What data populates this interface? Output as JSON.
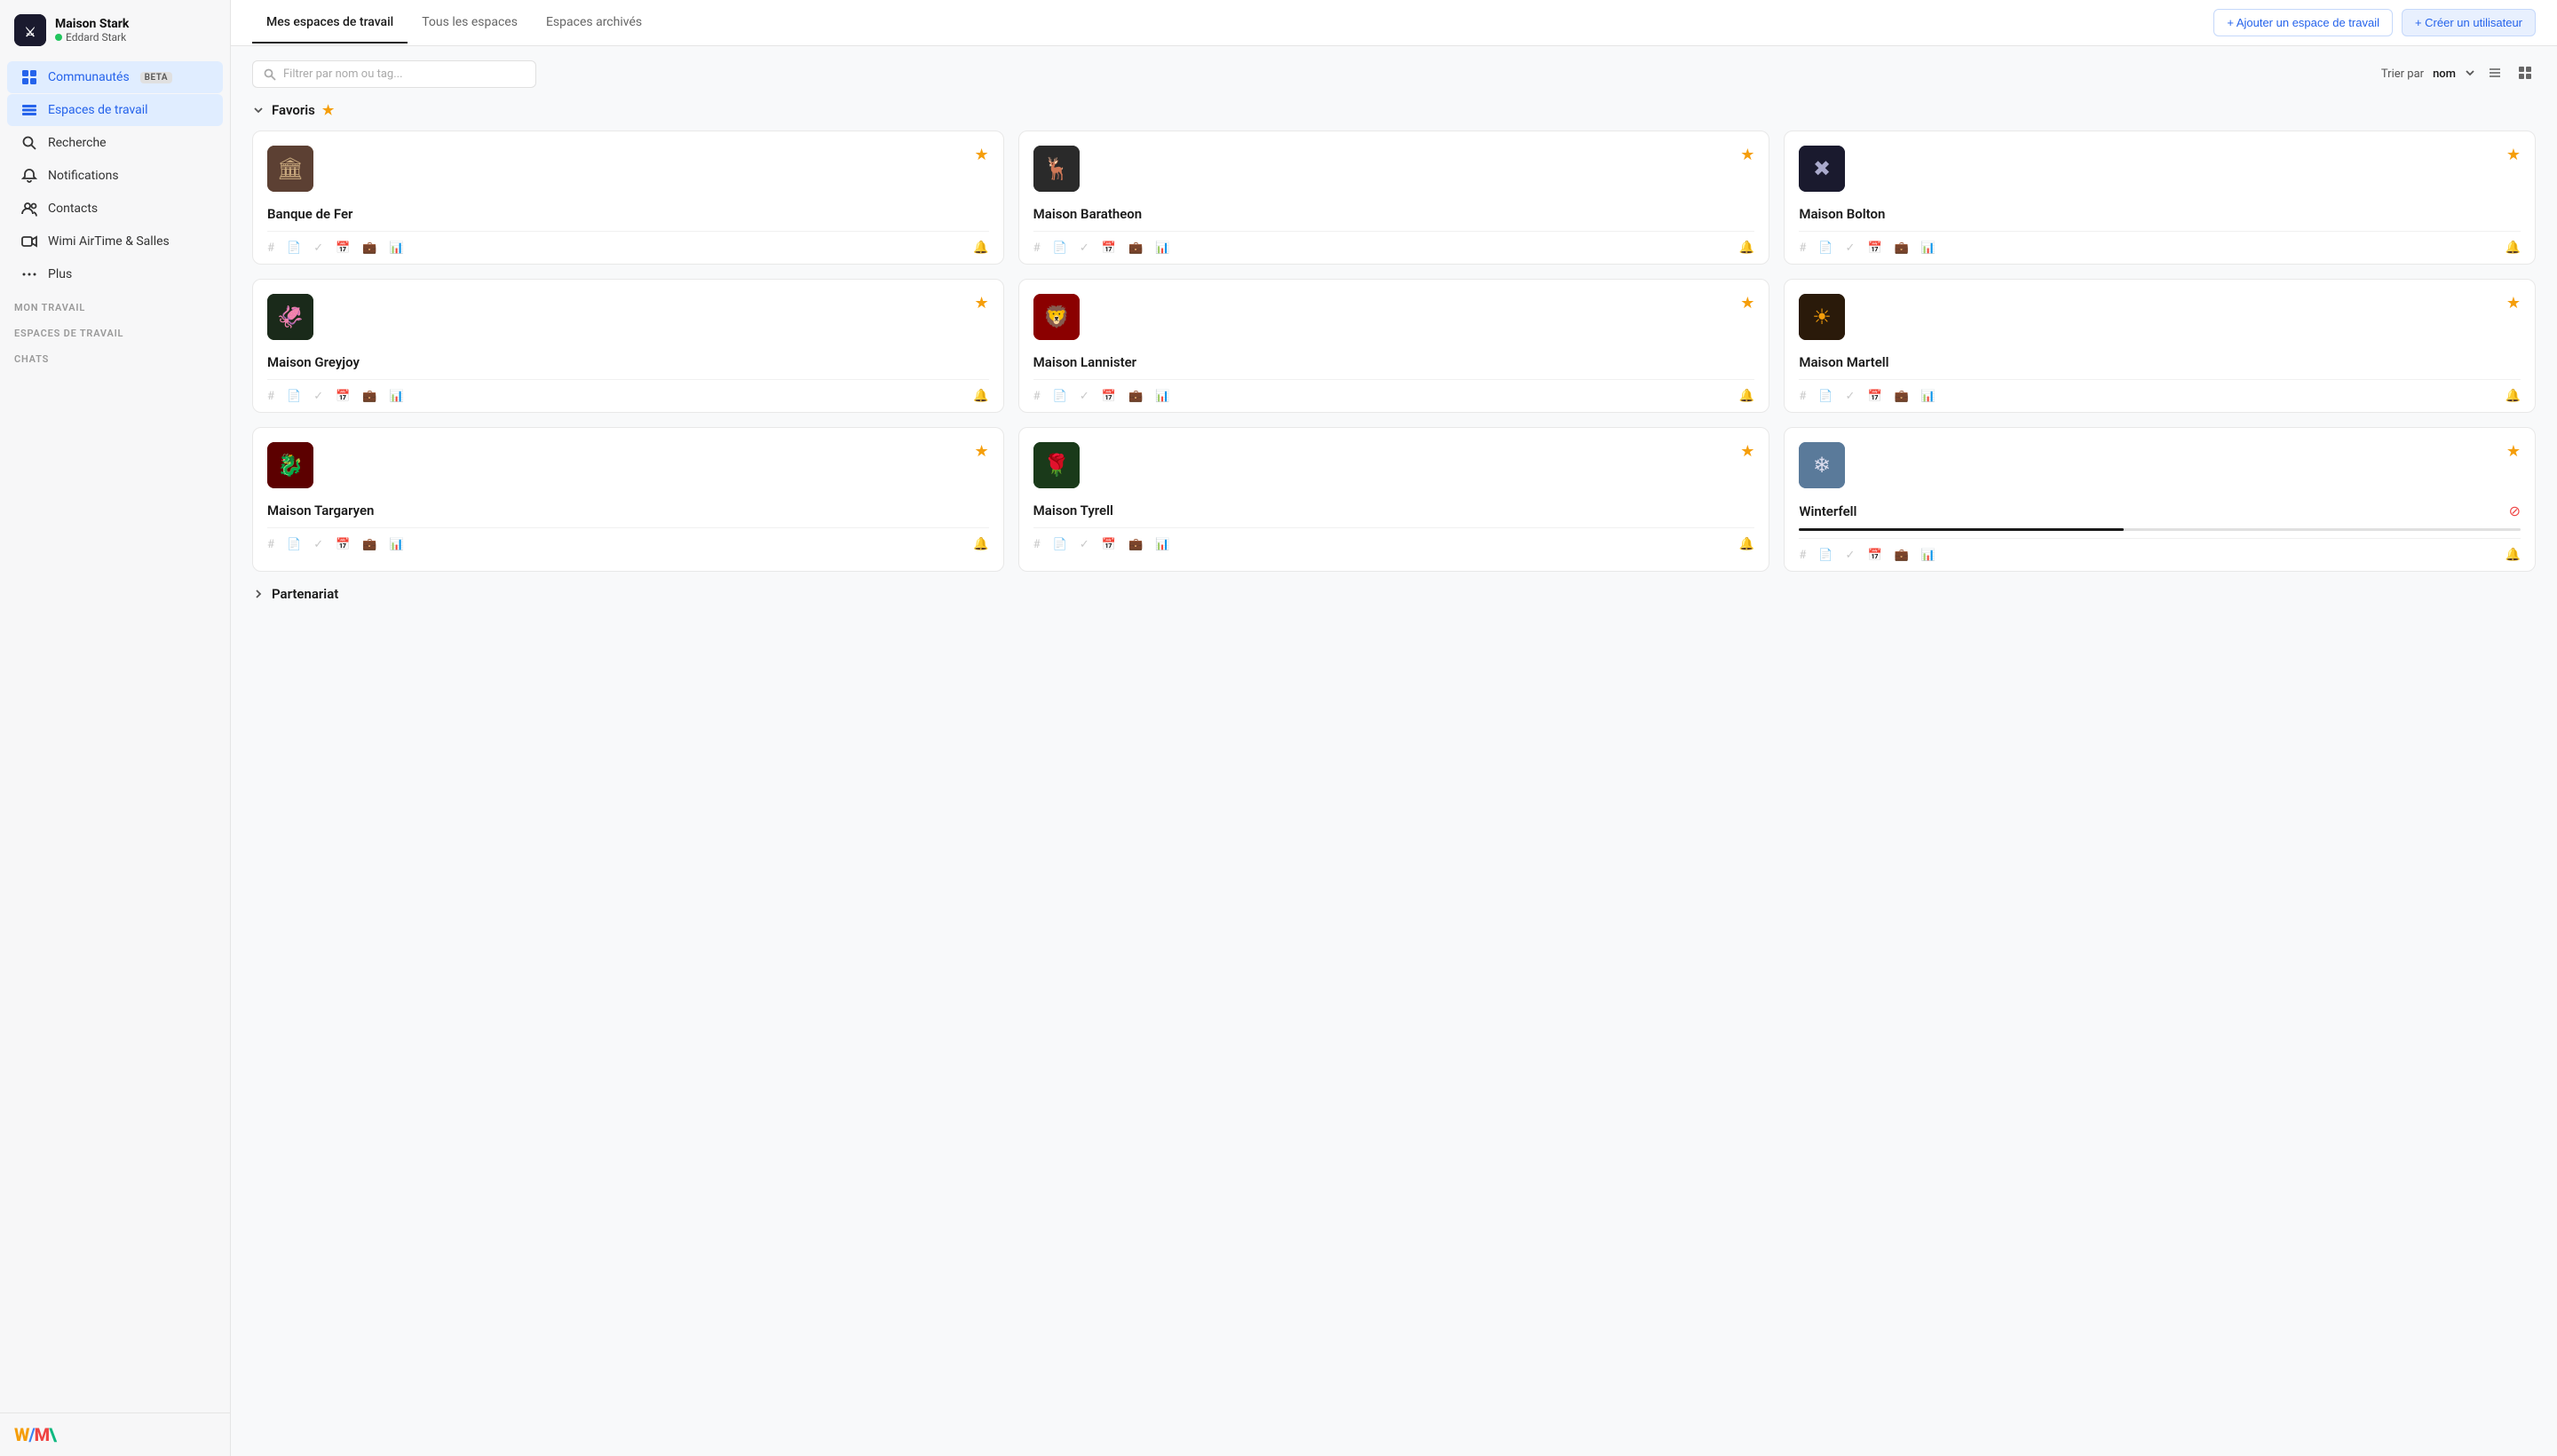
{
  "sidebar": {
    "company": "Maison Stark",
    "user": "Eddard Stark",
    "nav": [
      {
        "id": "communities",
        "label": "Communautés",
        "badge": "BETA",
        "icon": "grid"
      },
      {
        "id": "workspaces",
        "label": "Espaces de travail",
        "icon": "layers",
        "active": true
      },
      {
        "id": "search",
        "label": "Recherche",
        "icon": "search"
      },
      {
        "id": "notifications",
        "label": "Notifications",
        "icon": "bell"
      },
      {
        "id": "contacts",
        "label": "Contacts",
        "icon": "users"
      },
      {
        "id": "airtime",
        "label": "Wimi AirTime & Salles",
        "icon": "video"
      },
      {
        "id": "more",
        "label": "Plus",
        "icon": "more"
      }
    ],
    "sections": [
      {
        "label": "MON TRAVAIL"
      },
      {
        "label": "ESPACES DE TRAVAIL"
      },
      {
        "label": "CHATS"
      }
    ]
  },
  "tabs": [
    {
      "id": "mes-espaces",
      "label": "Mes espaces de travail",
      "active": true
    },
    {
      "id": "tous",
      "label": "Tous les espaces"
    },
    {
      "id": "archives",
      "label": "Espaces archivés"
    }
  ],
  "actions": {
    "add_workspace": "+ Ajouter un espace de travail",
    "create_user": "+ Créer un utilisateur"
  },
  "filter": {
    "placeholder": "Filtrer par nom ou tag...",
    "sort_label": "Trier par",
    "sort_value": "nom"
  },
  "sections": [
    {
      "id": "favoris",
      "label": "Favoris",
      "expanded": true,
      "cards": [
        {
          "id": "banque-fer",
          "name": "Banque de Fer",
          "img_class": "iron-bank",
          "starred": true,
          "emoji": "🏛"
        },
        {
          "id": "maison-baratheon",
          "name": "Maison Baratheon",
          "img_class": "baratheon",
          "starred": true,
          "emoji": "🦌"
        },
        {
          "id": "maison-bolton",
          "name": "Maison Bolton",
          "img_class": "bolton",
          "starred": true,
          "emoji": "✖"
        },
        {
          "id": "maison-greyjoy",
          "name": "Maison Greyjoy",
          "img_class": "greyjoy",
          "starred": true,
          "emoji": "🦑"
        },
        {
          "id": "maison-lannister",
          "name": "Maison Lannister",
          "img_class": "lannister",
          "starred": true,
          "emoji": "🦁"
        },
        {
          "id": "maison-martell",
          "name": "Maison Martell",
          "img_class": "martell",
          "starred": true,
          "emoji": "☀"
        },
        {
          "id": "maison-targaryen",
          "name": "Maison Targaryen",
          "img_class": "targaryen",
          "starred": true,
          "emoji": "🐉"
        },
        {
          "id": "maison-tyrell",
          "name": "Maison Tyrell",
          "img_class": "tyrell",
          "starred": true,
          "emoji": "🌹"
        },
        {
          "id": "winterfell",
          "name": "Winterfell",
          "img_class": "winterfell",
          "starred": true,
          "emoji": "❄",
          "has_progress": true
        }
      ]
    },
    {
      "id": "partenariat",
      "label": "Partenariat",
      "expanded": false,
      "cards": []
    }
  ],
  "wimi_logo": "W/M\\"
}
